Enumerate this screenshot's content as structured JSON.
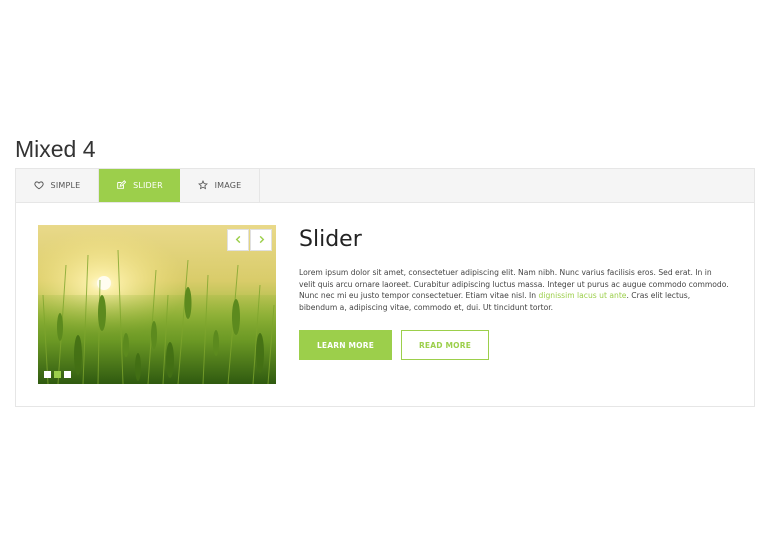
{
  "section": {
    "title": "Mixed 4"
  },
  "tabs": [
    {
      "label": "SIMPLE",
      "icon": "heart-icon",
      "active": false
    },
    {
      "label": "SLIDER",
      "icon": "edit-icon",
      "active": true
    },
    {
      "label": "IMAGE",
      "icon": "star-icon",
      "active": false
    }
  ],
  "slider": {
    "dots_count": 3,
    "active_dot": 1
  },
  "content": {
    "heading": "Slider",
    "body_before_link": "Lorem ipsum dolor sit amet, consectetuer adipiscing elit. Nam nibh. Nunc varius facilisis eros. Sed erat. In in velit quis arcu ornare laoreet. Curabitur adipiscing luctus massa. Integer ut purus ac augue commodo commodo. Nunc nec mi eu justo tempor consectetuer. Etiam vitae nisl. In ",
    "link_text": "dignissim lacus ut ante",
    "body_after_link": ". Cras elit lectus, bibendum a, adipiscing vitae, commodo et, dui. Ut tincidunt tortor."
  },
  "buttons": {
    "primary": "LEARN MORE",
    "secondary": "READ MORE"
  },
  "colors": {
    "accent": "#9ccf4b",
    "tab_bar": "#f5f5f5",
    "border": "#e6e6e6"
  }
}
